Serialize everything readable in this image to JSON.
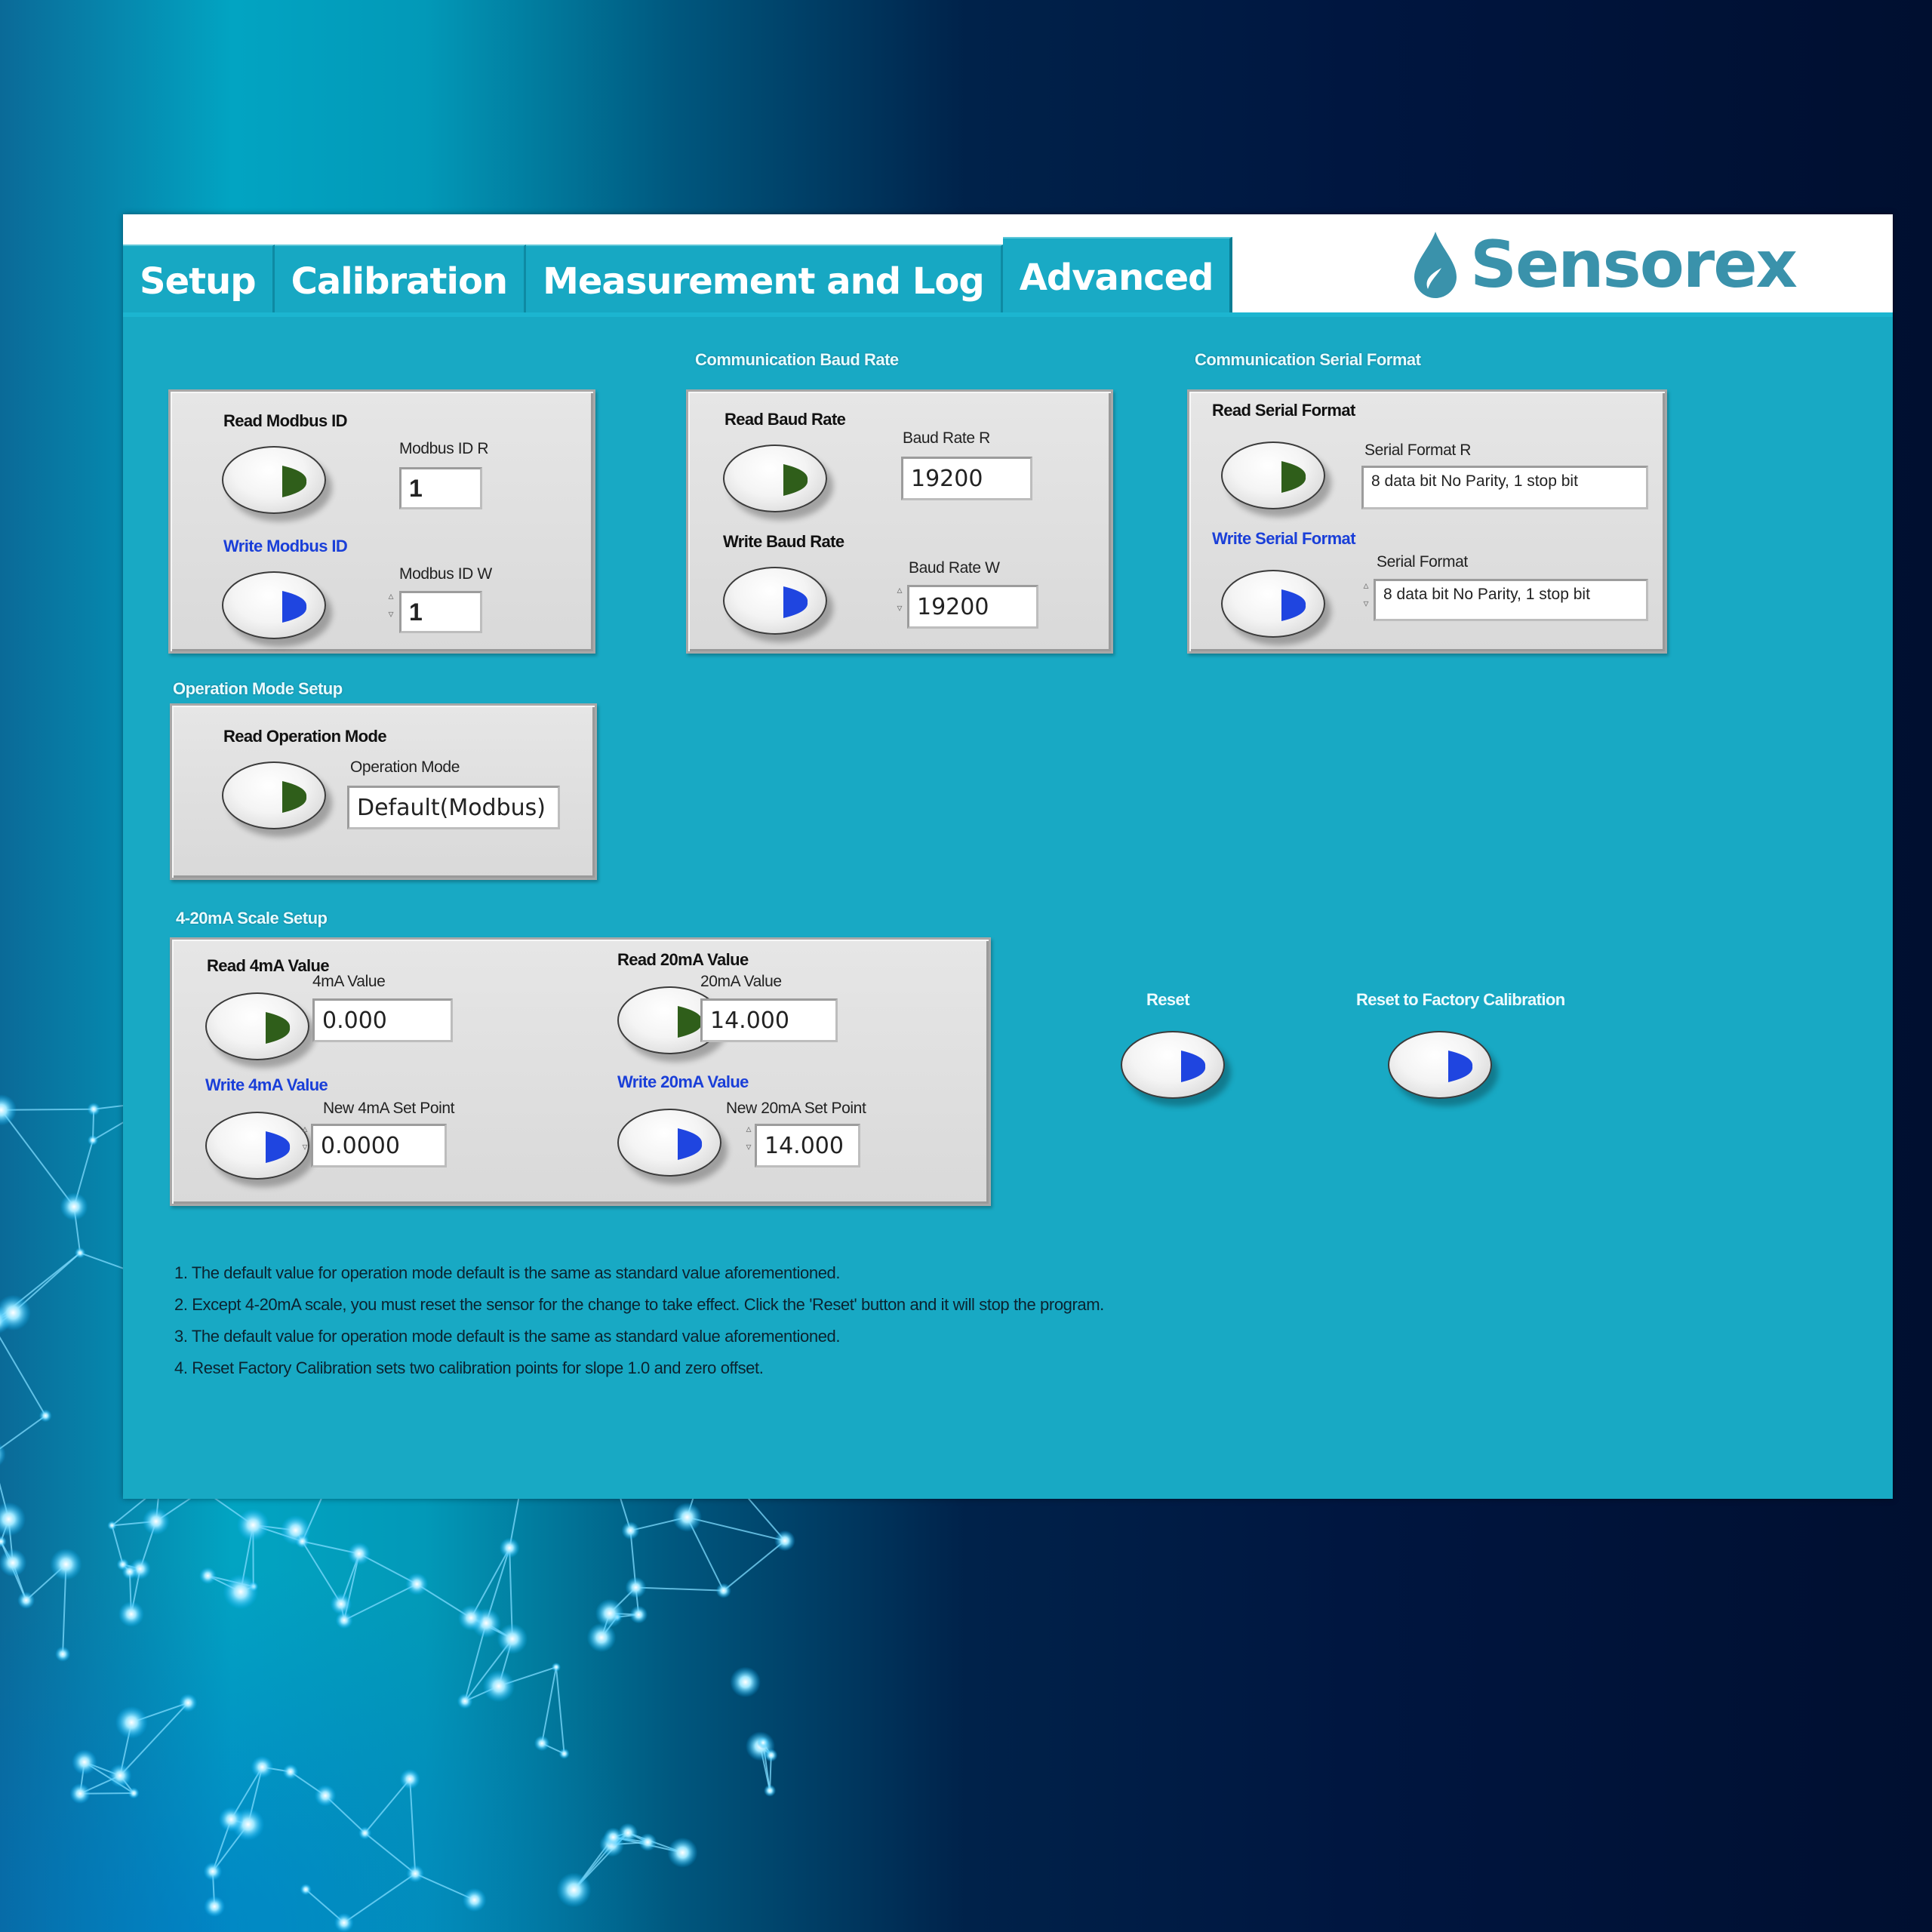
{
  "app": {
    "brand": "Sensorex",
    "colors": {
      "accent": "#18a9c4",
      "read_arrow": "#2f5e1a",
      "write_arrow": "#1f45e0",
      "write_label": "#1a3fd8",
      "brand": "#3a92ab"
    }
  },
  "tabs": [
    {
      "label": "Setup",
      "active": false
    },
    {
      "label": "Calibration",
      "active": false
    },
    {
      "label": "Measurement and Log",
      "active": true
    },
    {
      "label": "Advanced",
      "active": true
    }
  ],
  "modbus": {
    "read_label": "Read Modbus ID",
    "read_field_label": "Modbus  ID R",
    "read_value": "1",
    "write_label": "Write Modbus ID",
    "write_field_label": "Modbus  ID W",
    "write_value": "1"
  },
  "baud": {
    "title": "Communication Baud Rate",
    "read_label": "Read Baud Rate",
    "read_field_label": "Baud Rate R",
    "read_value": "19200",
    "write_label": "Write Baud Rate",
    "write_field_label": "Baud Rate W",
    "write_value": "19200"
  },
  "serial": {
    "title": "Communication Serial Format",
    "read_label": "Read Serial Format",
    "read_field_label": "Serial Format R",
    "read_value": "8 data bit No Parity, 1 stop bit",
    "write_label": "Write Serial Format",
    "write_field_label": "Serial Format",
    "write_value": "8 data bit No Parity, 1 stop bit"
  },
  "opmode": {
    "title": "Operation Mode Setup",
    "read_label": "Read Operation Mode",
    "field_label": "Operation Mode",
    "value": "Default(Modbus)"
  },
  "scale": {
    "title": "4-20mA Scale Setup",
    "read4_label": "Read 4mA Value",
    "val4_label": "4mA Value",
    "val4": "0.000",
    "write4_label": "Write 4mA Value",
    "new4_label": "New 4mA Set Point",
    "new4": "0.0000",
    "read20_label": "Read 20mA Value",
    "val20_label": "20mA Value",
    "val20": "14.000",
    "write20_label": "Write 20mA Value",
    "new20_label": "New 20mA Set Point",
    "new20": "14.000"
  },
  "actions": {
    "reset_label": "Reset",
    "factory_label": "Reset to Factory Calibration"
  },
  "notes": [
    "1.  The default value for operation mode default is the same as standard value aforementioned.",
    "2.  Except 4-20mA scale, you must reset the sensor for the change  to take effect. Click the 'Reset' button and it will stop the program.",
    "3. The default value for operation mode default is the same as standard value aforementioned.",
    "4. Reset Factory Calibration sets two calibration points for slope 1.0 and zero offset."
  ]
}
